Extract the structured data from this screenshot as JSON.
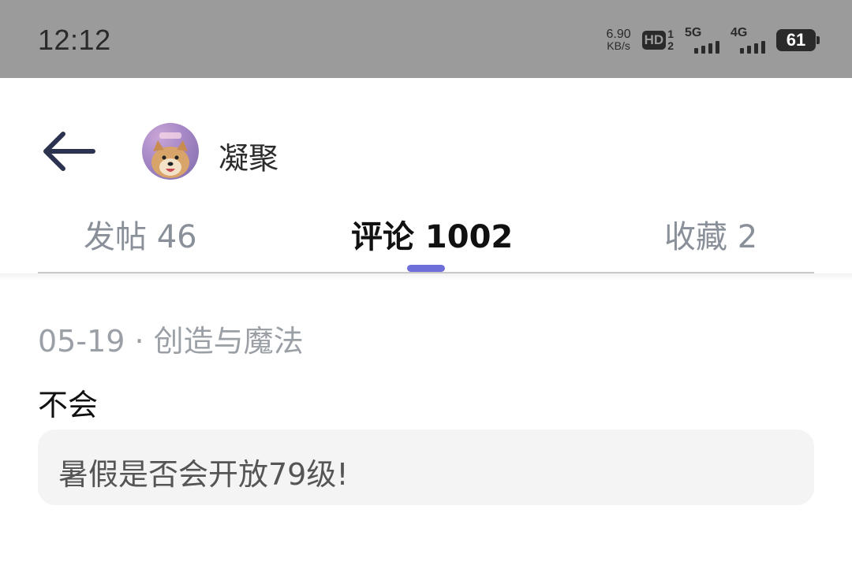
{
  "status_bar": {
    "time": "12:12",
    "net_speed_value": "6.90",
    "net_speed_unit": "KB/s",
    "hd_label": "HD",
    "hd_sub_top": "1",
    "hd_sub_bottom": "2",
    "signal_1_label": "5G",
    "signal_2_label": "4G",
    "battery_level": "61"
  },
  "header": {
    "back_icon": "arrow-left-icon",
    "avatar_icon": "shiba-dog-avatar",
    "username": "凝聚"
  },
  "tabs": [
    {
      "label": "发帖 46",
      "active": false
    },
    {
      "label": "评论 1002",
      "active": true
    },
    {
      "label": "收藏 2",
      "active": false
    }
  ],
  "colors": {
    "status_bar_bg": "#9b9b9b",
    "tab_indicator": "#6e6fd8",
    "quote_bg": "#f4f4f4",
    "meta_text": "#9aa0a6"
  },
  "comment": {
    "meta": "05-19 · 创造与魔法",
    "reply": "不会",
    "quoted": "暑假是否会开放79级!"
  }
}
